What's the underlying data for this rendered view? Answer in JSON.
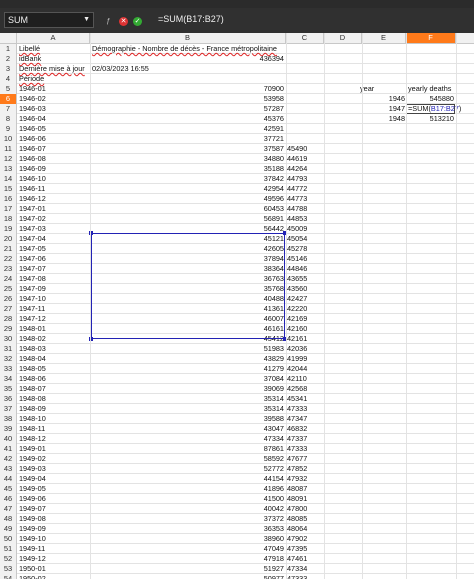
{
  "formula_bar": {
    "name_box": "SUM",
    "formula": "=SUM(B17:B27)"
  },
  "columns": [
    "A",
    "B",
    "C",
    "D",
    "E",
    "F"
  ],
  "active_column": "F",
  "active_row": "6",
  "header_rows": [
    {
      "row": "1",
      "A": "Libellé",
      "B": "Démographie - Nombre de décès - France métropolitaine"
    },
    {
      "row": "2",
      "A": "idBank",
      "B": "436394"
    },
    {
      "row": "3",
      "A": "Dernière mise à jour",
      "B": "02/03/2023 16:55"
    },
    {
      "row": "4",
      "A": "Période",
      "B": ""
    }
  ],
  "data_rows": [
    {
      "row": "5",
      "A": "1946-01",
      "B": "70900",
      "C": ""
    },
    {
      "row": "6",
      "A": "1946-02",
      "B": "53958",
      "C": ""
    },
    {
      "row": "7",
      "A": "1946-03",
      "B": "57287",
      "C": ""
    },
    {
      "row": "8",
      "A": "1946-04",
      "B": "45376",
      "C": ""
    },
    {
      "row": "9",
      "A": "1946-05",
      "B": "42591",
      "C": ""
    },
    {
      "row": "10",
      "A": "1946-06",
      "B": "37721",
      "C": ""
    },
    {
      "row": "11",
      "A": "1946-07",
      "B": "37587",
      "C": "45490"
    },
    {
      "row": "12",
      "A": "1946-08",
      "B": "34880",
      "C": "44619"
    },
    {
      "row": "13",
      "A": "1946-09",
      "B": "35188",
      "C": "44264"
    },
    {
      "row": "14",
      "A": "1946-10",
      "B": "37842",
      "C": "44793"
    },
    {
      "row": "15",
      "A": "1946-11",
      "B": "42954",
      "C": "44772"
    },
    {
      "row": "16",
      "A": "1946-12",
      "B": "49596",
      "C": "44773"
    },
    {
      "row": "17",
      "A": "1947-01",
      "B": "60453",
      "C": "44788"
    },
    {
      "row": "18",
      "A": "1947-02",
      "B": "56891",
      "C": "44853"
    },
    {
      "row": "19",
      "A": "1947-03",
      "B": "56442",
      "C": "45009"
    },
    {
      "row": "20",
      "A": "1947-04",
      "B": "45121",
      "C": "45054"
    },
    {
      "row": "21",
      "A": "1947-05",
      "B": "42605",
      "C": "45278"
    },
    {
      "row": "22",
      "A": "1947-06",
      "B": "37894",
      "C": "45146"
    },
    {
      "row": "23",
      "A": "1947-07",
      "B": "38364",
      "C": "44846"
    },
    {
      "row": "24",
      "A": "1947-08",
      "B": "36763",
      "C": "43655"
    },
    {
      "row": "25",
      "A": "1947-09",
      "B": "35768",
      "C": "43560"
    },
    {
      "row": "26",
      "A": "1947-10",
      "B": "40488",
      "C": "42427"
    },
    {
      "row": "27",
      "A": "1947-11",
      "B": "41361",
      "C": "42220"
    },
    {
      "row": "28",
      "A": "1947-12",
      "B": "46007",
      "C": "42169"
    },
    {
      "row": "29",
      "A": "1948-01",
      "B": "46161",
      "C": "42160"
    },
    {
      "row": "30",
      "A": "1948-02",
      "B": "45412",
      "C": "42161"
    },
    {
      "row": "31",
      "A": "1948-03",
      "B": "51983",
      "C": "42036"
    },
    {
      "row": "32",
      "A": "1948-04",
      "B": "43829",
      "C": "41999"
    },
    {
      "row": "33",
      "A": "1948-05",
      "B": "41279",
      "C": "42044"
    },
    {
      "row": "34",
      "A": "1948-06",
      "B": "37084",
      "C": "42110"
    },
    {
      "row": "35",
      "A": "1948-07",
      "B": "39069",
      "C": "42568"
    },
    {
      "row": "36",
      "A": "1948-08",
      "B": "35314",
      "C": "45341"
    },
    {
      "row": "37",
      "A": "1948-09",
      "B": "35314",
      "C": "47333"
    },
    {
      "row": "38",
      "A": "1948-10",
      "B": "39588",
      "C": "47347"
    },
    {
      "row": "39",
      "A": "1948-11",
      "B": "43047",
      "C": "46832"
    },
    {
      "row": "40",
      "A": "1948-12",
      "B": "47334",
      "C": "47337"
    },
    {
      "row": "41",
      "A": "1949-01",
      "B": "87861",
      "C": "47333"
    },
    {
      "row": "42",
      "A": "1949-02",
      "B": "58592",
      "C": "47677"
    },
    {
      "row": "43",
      "A": "1949-03",
      "B": "52772",
      "C": "47852"
    },
    {
      "row": "44",
      "A": "1949-04",
      "B": "44154",
      "C": "47932"
    },
    {
      "row": "45",
      "A": "1949-05",
      "B": "41896",
      "C": "48087"
    },
    {
      "row": "46",
      "A": "1949-06",
      "B": "41500",
      "C": "48091"
    },
    {
      "row": "47",
      "A": "1949-07",
      "B": "40042",
      "C": "47800"
    },
    {
      "row": "48",
      "A": "1949-08",
      "B": "37372",
      "C": "48085"
    },
    {
      "row": "49",
      "A": "1949-09",
      "B": "36353",
      "C": "48064"
    },
    {
      "row": "50",
      "A": "1949-10",
      "B": "38960",
      "C": "47902"
    },
    {
      "row": "51",
      "A": "1949-11",
      "B": "47049",
      "C": "47395"
    },
    {
      "row": "52",
      "A": "1949-12",
      "B": "47918",
      "C": "47461"
    },
    {
      "row": "53",
      "A": "1950-01",
      "B": "51927",
      "C": "47334"
    },
    {
      "row": "54",
      "A": "1950-02",
      "B": "50977",
      "C": "47333"
    },
    {
      "row": "55",
      "A": "1950-03",
      "B": "50439",
      "C": "47583"
    }
  ],
  "side_table": {
    "rows": [
      {
        "row": "5",
        "E": "year",
        "F": "yearly deaths"
      },
      {
        "row": "6",
        "E": "1946",
        "F": "545880"
      },
      {
        "row": "7",
        "E": "1947",
        "F": "=SUM(B17:B27)"
      },
      {
        "row": "8",
        "E": "1948",
        "F": "513210"
      }
    ]
  },
  "colors": {
    "accent": "#ff7a1a",
    "selection": "#2323b5",
    "toolbar": "#303030"
  }
}
